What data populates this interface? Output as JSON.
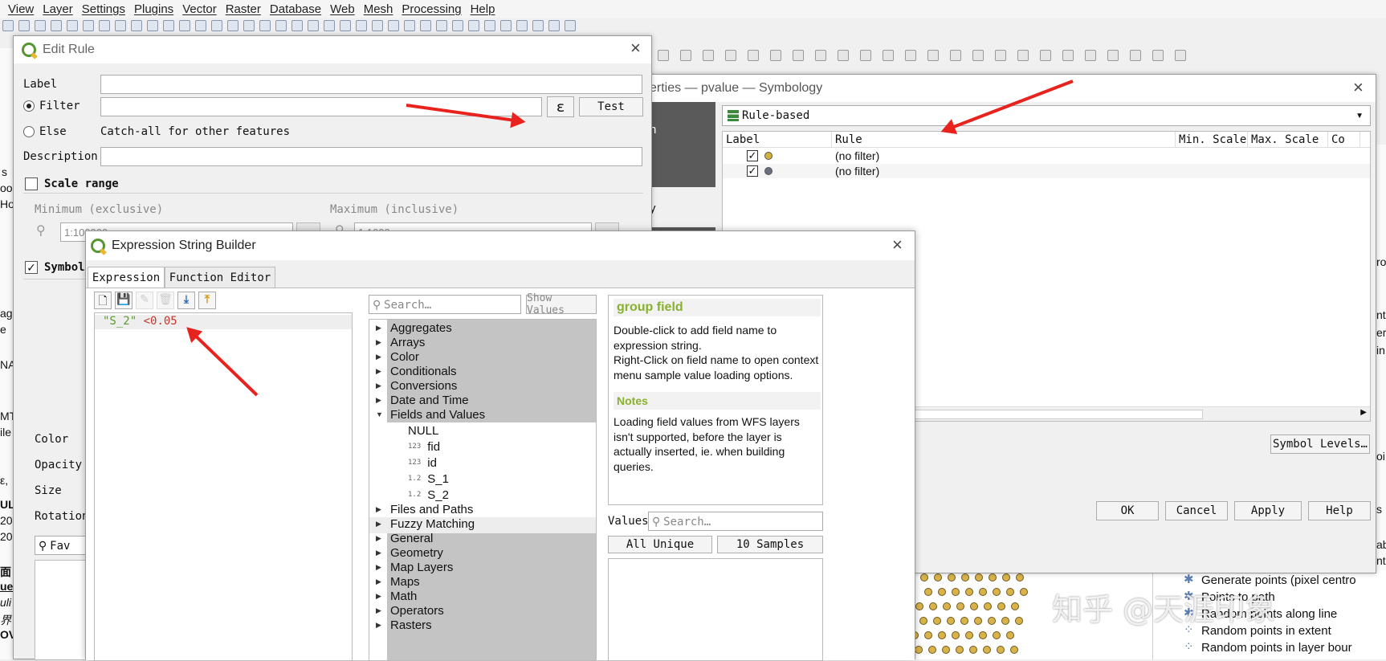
{
  "menubar": [
    "View",
    "Layer",
    "Settings",
    "Plugins",
    "Vector",
    "Raster",
    "Database",
    "Web",
    "Mesh",
    "Processing",
    "Help"
  ],
  "left_strip": [
    "s",
    "oo",
    "Ho",
    "ag",
    "e",
    "NA",
    "MT",
    "ile",
    "ε,",
    "UL",
    "20",
    "20",
    "面",
    "ue",
    "uli",
    "界",
    "OV"
  ],
  "right_panel": {
    "items": [
      "Generate points (pixel centro",
      "Points to path",
      "Random points along line",
      "Random points in extent",
      "Random points in layer bour"
    ],
    "fragments": [
      "ro",
      "nt",
      "er",
      "in",
      "oi",
      "s",
      "ab",
      "ntr"
    ]
  },
  "layer_props": {
    "title": "erties — pvalue — Symbology",
    "renderer": "Rule-based",
    "side_items": [
      "n",
      "y"
    ],
    "columns": [
      "Label",
      "Rule",
      "Min. Scale",
      "Max. Scale",
      "Co"
    ],
    "rows": [
      {
        "rule": "(no filter)",
        "color": "#d4b03c"
      },
      {
        "rule": "(no filter)",
        "color": "#6a7080"
      }
    ],
    "symbol_levels": "Symbol Levels…",
    "buttons": {
      "ok": "OK",
      "cancel": "Cancel",
      "apply": "Apply",
      "help": "Help"
    }
  },
  "edit_rule": {
    "title": "Edit Rule",
    "label": "Label",
    "filter": "Filter",
    "epsilon": "ε",
    "test": "Test",
    "else": "Else",
    "catch_all": "Catch-all for other features",
    "description": "Description",
    "scale_range": "Scale range",
    "minimum": "Minimum (exclusive)",
    "maximum": "Maximum (inclusive)",
    "min_value": "1:100000",
    "max_value": "1:1000",
    "symbol": "Symbol",
    "color": "Color",
    "opacity": "Opacity",
    "size": "Size",
    "rotation": "Rotation",
    "favorites": "Fav"
  },
  "expr_builder": {
    "title": "Expression String Builder",
    "tabs": [
      "Expression",
      "Function Editor"
    ],
    "expression_field": "\"S_2\"",
    "expression_rest": " <0.05",
    "search_placeholder": "Search…",
    "show_values": "Show Values",
    "tree": [
      {
        "label": "Aggregates",
        "expanded": false
      },
      {
        "label": "Arrays",
        "expanded": false
      },
      {
        "label": "Color",
        "expanded": false
      },
      {
        "label": "Conditionals",
        "expanded": false
      },
      {
        "label": "Conversions",
        "expanded": false
      },
      {
        "label": "Date and Time",
        "expanded": false
      },
      {
        "label": "Fields and Values",
        "expanded": true
      }
    ],
    "fields": [
      {
        "type": "",
        "name": "NULL"
      },
      {
        "type": "123",
        "name": "fid"
      },
      {
        "type": "123",
        "name": "id"
      },
      {
        "type": "1.2",
        "name": "S_1"
      },
      {
        "type": "1.2",
        "name": "S_2"
      }
    ],
    "tree_after": [
      "Files and Paths",
      "Fuzzy Matching",
      "General",
      "Geometry",
      "Map Layers",
      "Maps",
      "Math",
      "Operators",
      "Rasters"
    ],
    "help_title": "group field",
    "help_text": "Double-click to add field name to expression string.\nRight-Click on field name to open context menu sample value loading options.",
    "notes_title": "Notes",
    "notes_text": "Loading field values from WFS layers isn't supported, before the layer is actually inserted, ie. when building queries.",
    "values_label": "Values",
    "values_search": "Search…",
    "all_unique": "All Unique",
    "samples": "10 Samples"
  },
  "watermark": "知乎 @天涯印象"
}
